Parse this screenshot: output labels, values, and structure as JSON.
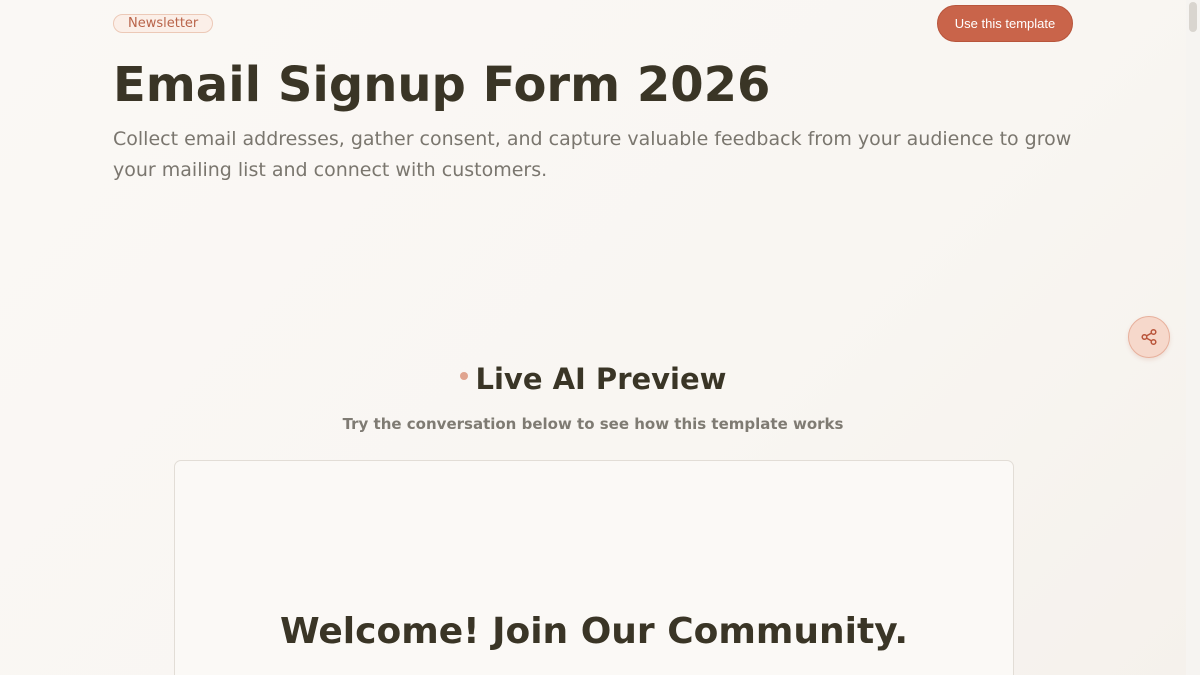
{
  "header": {
    "badge_label": "Newsletter",
    "cta_label": "Use this template",
    "title": "Email Signup Form 2026",
    "subtitle": "Collect email addresses, gather consent, and capture valuable feedback from your audience to grow your mailing list and connect with customers."
  },
  "share": {
    "icon": "share-icon"
  },
  "preview": {
    "title": "Live AI Preview",
    "subtitle": "Try the conversation below to see how this template works"
  },
  "chat": {
    "welcome": "Welcome! Join Our Community."
  },
  "colors": {
    "accent": "#c9644a",
    "text_dark": "#3a3526",
    "text_muted": "#7a766e",
    "background": "#faf8f5"
  }
}
